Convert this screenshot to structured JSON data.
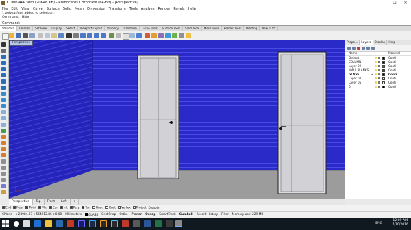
{
  "window": {
    "title": "COMP-APP.3dm (20646 KB) - Rhinoceros Corporate (64-bit) - [Perspective]",
    "controls": [
      "—",
      "☐",
      "✕"
    ]
  },
  "menu": [
    "File",
    "Edit",
    "View",
    "Curve",
    "Surface",
    "Solid",
    "Mesh",
    "Dimension",
    "Transform",
    "Tools",
    "Analyze",
    "Render",
    "Panels",
    "Help"
  ],
  "command_history": [
    "1 polysurface added to selection.",
    "Command: _Hide"
  ],
  "command_prompt": "Command:",
  "toolbar_tabs": [
    "Standard",
    "CPlanes",
    "Set View",
    "Display",
    "Select",
    "Viewport Layout",
    "Visibility",
    "Transform",
    "Curve Tools",
    "Surface Tools",
    "Solid Tools",
    "Mesh Tools",
    "Render Tools",
    "Drafting",
    "New in V5"
  ],
  "viewport": {
    "label": "Perspective",
    "wall_color": "#2a2ac9",
    "floor_color": "#9a9a9a",
    "door_color": "#d9d9dd"
  },
  "panel": {
    "tabs": [
      "Prope...",
      "Layers",
      "Display",
      "Help"
    ],
    "active_tab": "Layers",
    "headers": {
      "name": "Name",
      "material": "Material"
    },
    "layers": [
      {
        "name": "Default",
        "color": "#000000",
        "material": "Conti"
      },
      {
        "name": "COLUMN",
        "color": "#000000",
        "material": "Conti"
      },
      {
        "name": "Layer 02",
        "color": "#2ca02c",
        "material": "Conti"
      },
      {
        "name": "WALL PLANKS",
        "color": "#1f3fbf",
        "material": "Conti"
      },
      {
        "name": "GLASS",
        "color": "#000000",
        "material": "Conti",
        "current": true
      },
      {
        "name": "Layer 04",
        "color": "#e9e9e9",
        "material": "Conti"
      },
      {
        "name": "Layer 05",
        "color": "#e9e9e9",
        "material": "Conti"
      },
      {
        "name": "0",
        "color": "#000000",
        "material": "Conti"
      }
    ]
  },
  "viewport_tabs": [
    "Perspective",
    "Top",
    "Front",
    "Left",
    "+"
  ],
  "osnap": [
    "End",
    "Near",
    "Point",
    "Mid",
    "Cen",
    "Int",
    "Perp",
    "Tan",
    "Quad",
    "Knot",
    "Vertex",
    "Project",
    "Disable"
  ],
  "osnap_checked": [
    "End",
    "Near",
    "Point",
    "Mid",
    "Cen",
    "Int",
    "Perp",
    "Tan"
  ],
  "status": {
    "cplane": "CPlane",
    "coords": "x 28984.07  y 564912.86  z 0.00",
    "units": "Millimeters",
    "layer": "GLASS",
    "toggles": [
      "Grid Snap",
      "Ortho",
      "Planar",
      "Osnap",
      "SmartTrack",
      "Gumball",
      "Record History",
      "Filter"
    ],
    "memory": "Memory use: 229 MB"
  },
  "taskbar": {
    "language": "ENG",
    "time": "12:09 AM",
    "date": "7/10/2016"
  }
}
